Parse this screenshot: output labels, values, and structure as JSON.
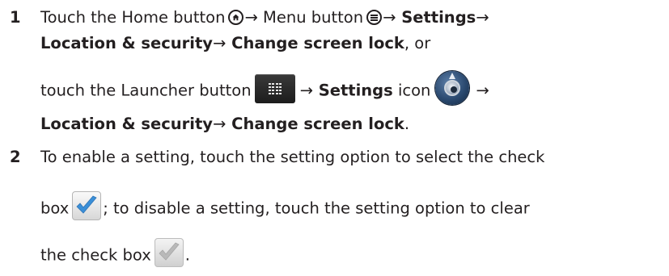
{
  "steps": [
    {
      "number": "1",
      "line1": {
        "t1": "Touch the Home button",
        "arrow1": "→",
        "t2": " Menu button",
        "arrow2": "→",
        "b1": " Settings",
        "arrow3": "→"
      },
      "line2": {
        "b1": "Location & security",
        "arrow1": "→",
        "b2": " Change screen lock",
        "t1": ", or"
      },
      "line3": {
        "t1": "touch the Launcher button",
        "arrow1": "→",
        "b1": " Settings",
        "t2": " icon",
        "arrow2": "→"
      },
      "line4": {
        "b1": "Location & security",
        "arrow1": "→",
        "b2": " Change screen lock",
        "t1": "."
      }
    },
    {
      "number": "2",
      "line1": {
        "t1": "To enable a setting, touch the setting option to select the check"
      },
      "line2": {
        "t1": "box",
        "t2": "; to disable a setting, touch the setting option to clear"
      },
      "line3": {
        "t1": "the check box",
        "t2": "."
      }
    }
  ],
  "icons": {
    "home": "home-button-icon",
    "menu": "menu-button-icon",
    "launcher": "launcher-button-icon",
    "settings": "settings-app-icon",
    "check_on": "checkbox-selected-icon",
    "check_off": "checkbox-cleared-icon"
  },
  "colors": {
    "text": "#231f20",
    "check_selected": "#3a8fd8",
    "check_cleared": "#b9b9b9"
  }
}
